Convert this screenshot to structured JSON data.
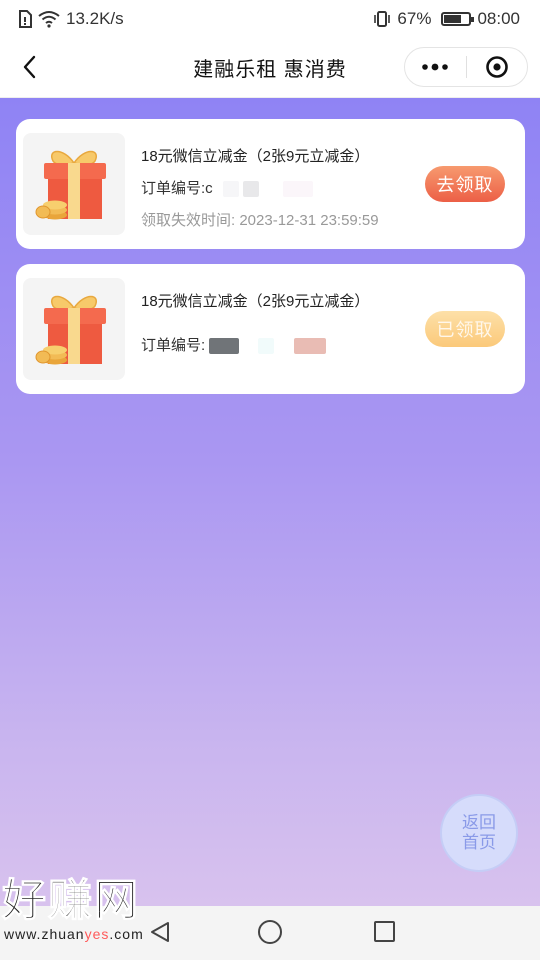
{
  "status_bar": {
    "speed": "13.2K/s",
    "battery": "67%",
    "battery_level": 0.67,
    "time": "08:00"
  },
  "nav": {
    "title": "建融乐租 惠消费",
    "back_icon": "chevron-left-icon",
    "more_icon": "more-dots-icon",
    "close_icon": "target-close-icon"
  },
  "coupons": [
    {
      "title": "18元微信立减金（2张9元立减金）",
      "order_label": "订单编号:c",
      "expire": "领取失效时间: 2023-12-31 23:59:59",
      "button": "去领取",
      "state": "claim"
    },
    {
      "title": "18元微信立减金（2张9元立减金）",
      "order_label": "订单编号:",
      "expire": "",
      "button": "已领取",
      "state": "claimed"
    }
  ],
  "home_button": {
    "line1": "返回",
    "line2": "首页"
  },
  "watermark": {
    "big": "好赚网",
    "small_prefix": "www.zhuan",
    "small_accent": "yes",
    "small_suffix": ".com"
  },
  "colors": {
    "gradient_top": "#8f83f4",
    "gradient_bottom": "#d8c2ee",
    "claim_button": "#ec5f46",
    "claimed_button": "#fbc97a"
  }
}
